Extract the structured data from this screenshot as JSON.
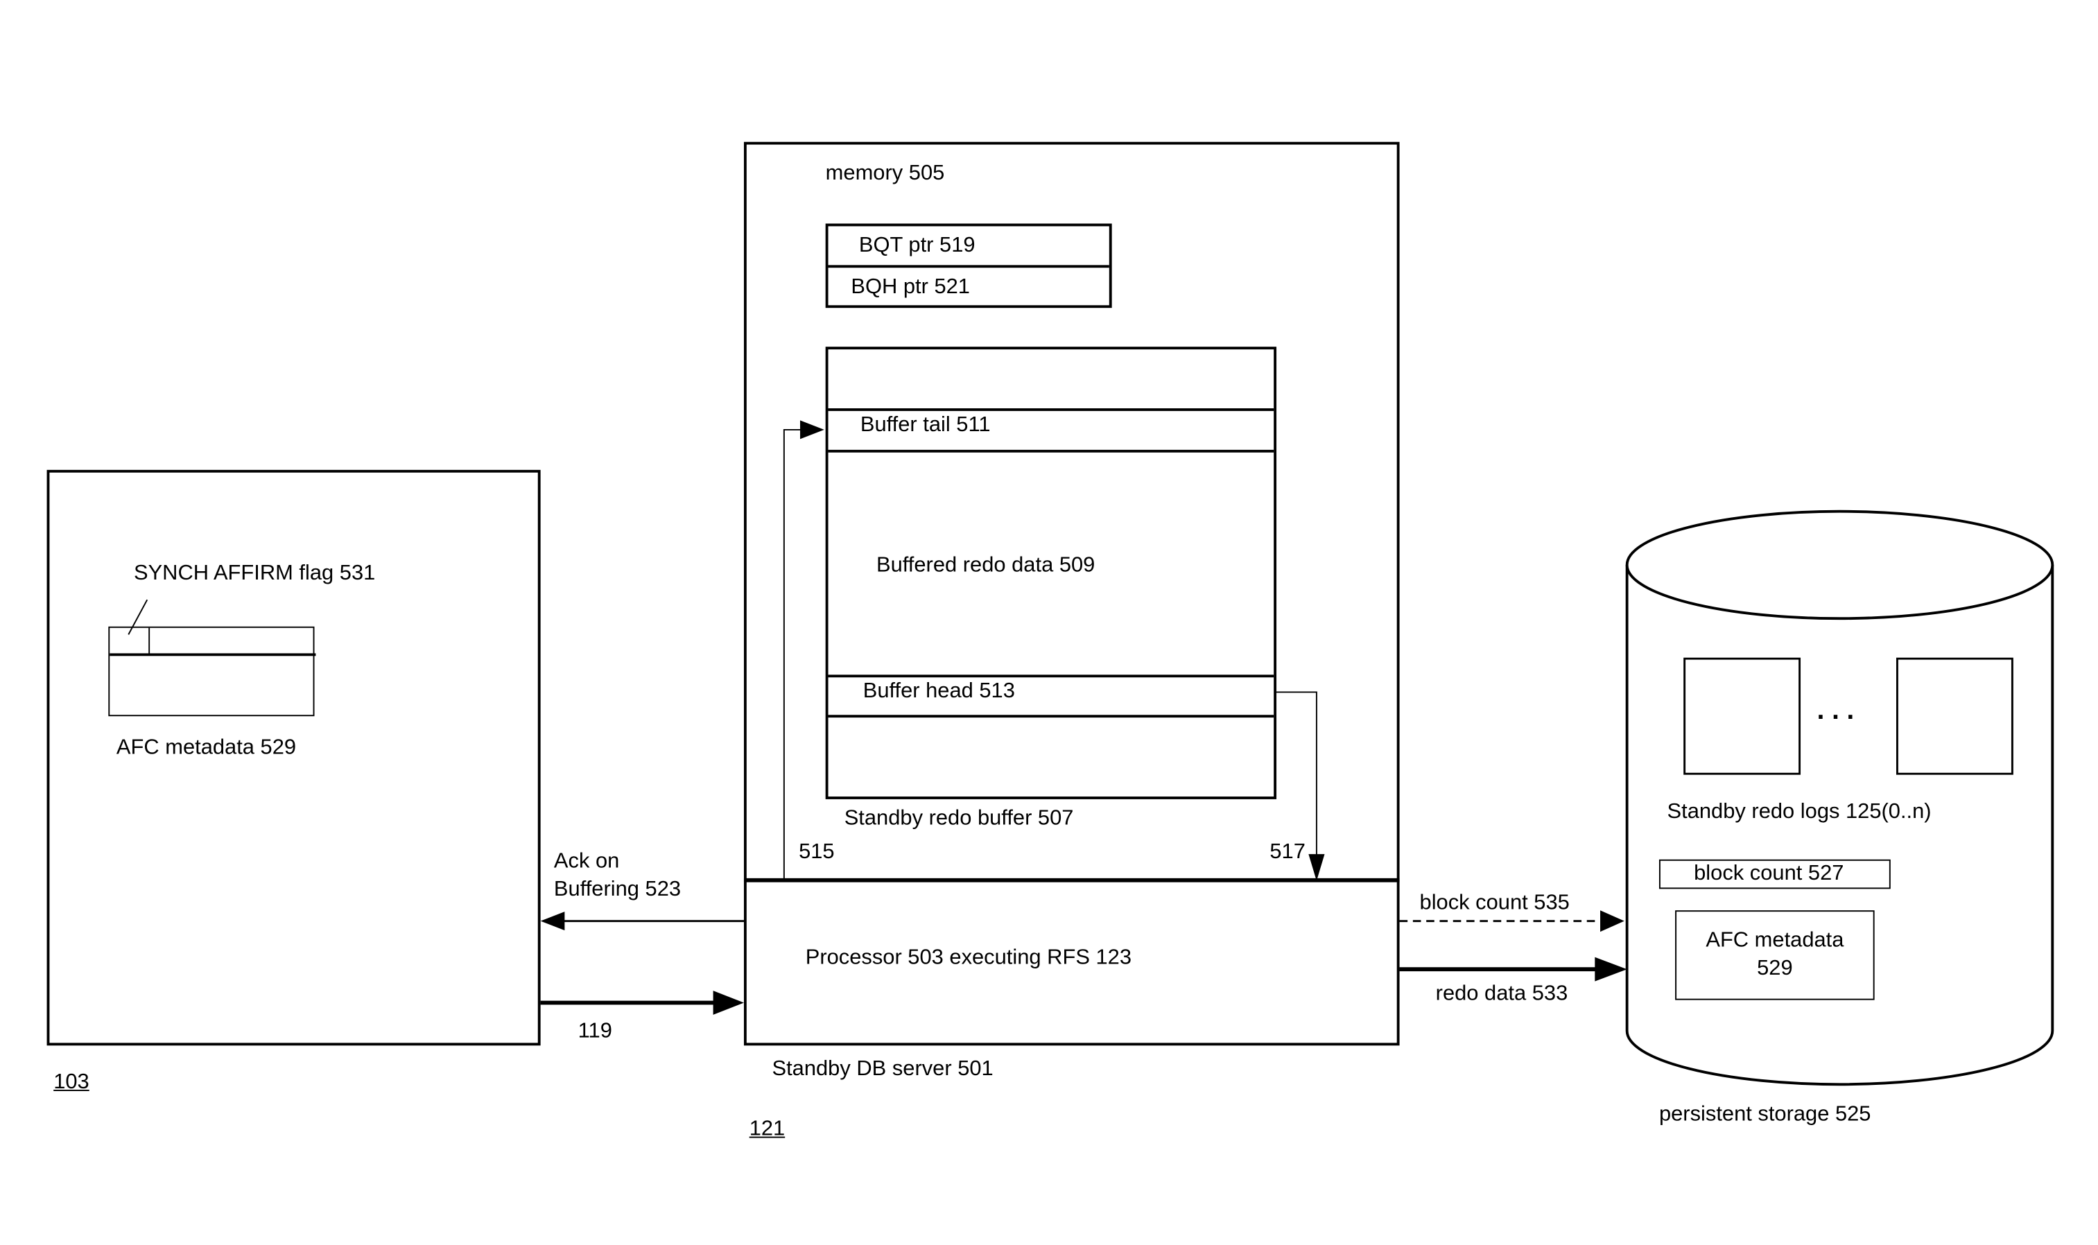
{
  "primary_system": {
    "ref_label": "103",
    "flag_label": "SYNCH AFFIRM flag 531",
    "metadata_label": "AFC metadata 529"
  },
  "standby_system": {
    "ref_label": "121",
    "server_label": "Standby DB server 501",
    "memory": {
      "label": "memory 505",
      "pointers": [
        {
          "label": "BQT ptr 519"
        },
        {
          "label": "BQH ptr 521"
        }
      ],
      "buffer": {
        "caption": "Standby redo buffer 507",
        "tail_label": "Buffer tail 511",
        "data_label": "Buffered redo data 509",
        "head_label": "Buffer head 513"
      },
      "tail_link_label": "515",
      "head_link_label": "517"
    },
    "processor_label": "Processor  503 executing RFS 123"
  },
  "links": {
    "ack_label_line1": "Ack on",
    "ack_label_line2": "Buffering 523",
    "redo_stream_label": "119",
    "block_count_label": "block count 535",
    "redo_data_label": "redo data 533"
  },
  "storage": {
    "caption": "persistent storage 525",
    "logs_label": "Standby redo logs 125(0..n)",
    "ellipsis": ". . .",
    "block_count_label": "block count 527",
    "metadata_label_line1": "AFC metadata",
    "metadata_label_line2": "529"
  }
}
